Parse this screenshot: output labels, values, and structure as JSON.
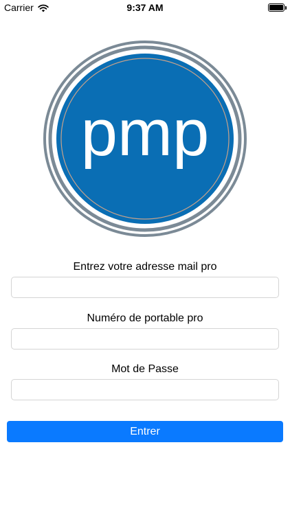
{
  "status_bar": {
    "carrier": "Carrier",
    "time": "9:37 AM"
  },
  "logo": {
    "text": "pmp",
    "brand_color": "#0a6eb4",
    "ring_color": "#7b8a96"
  },
  "form": {
    "email_label": "Entrez votre adresse mail pro",
    "email_value": "",
    "phone_label": "Numéro de portable pro",
    "phone_value": "",
    "password_label": "Mot de Passe",
    "password_value": "",
    "submit_label": "Entrer"
  },
  "colors": {
    "button": "#0a7aff",
    "input_border": "#d4d4d4"
  }
}
